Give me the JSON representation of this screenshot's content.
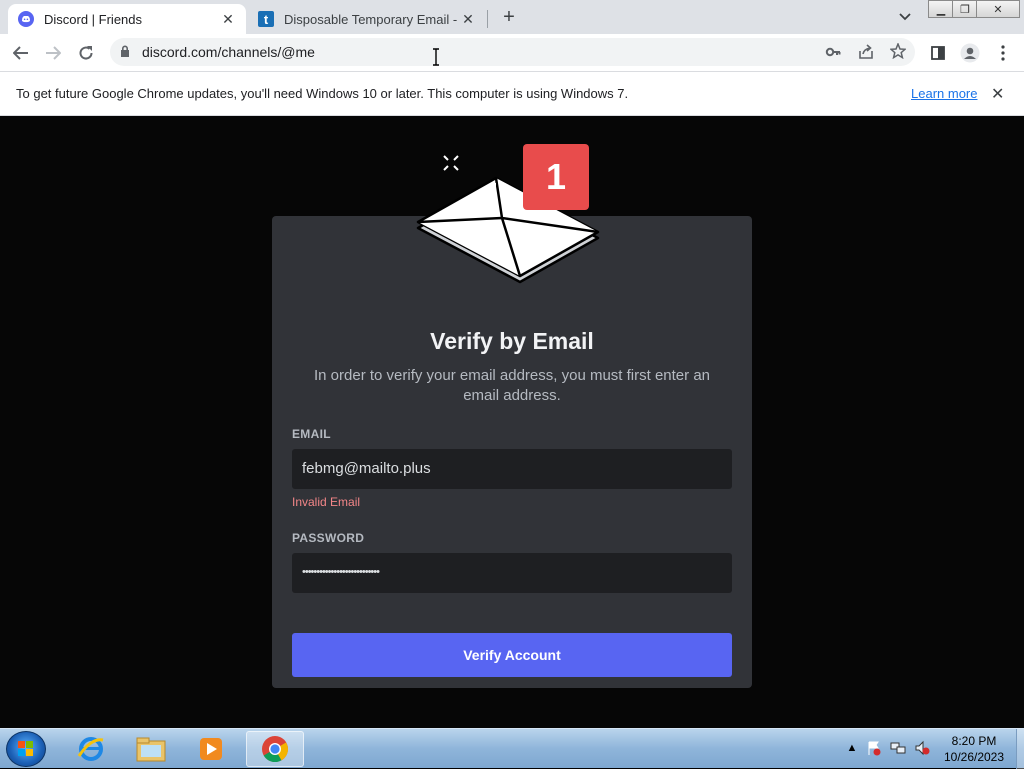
{
  "browser": {
    "tabs": [
      {
        "title": "Discord | Friends",
        "favicon": "discord-icon",
        "active": true
      },
      {
        "title": "Disposable Temporary Email - Te",
        "favicon": "t-icon",
        "active": false
      }
    ],
    "address_bar": {
      "url": "discord.com/channels/@me"
    },
    "infobar": {
      "message": "To get future Google Chrome updates, you'll need Windows 10 or later. This computer is using Windows 7.",
      "link": "Learn more"
    }
  },
  "modal": {
    "badge": "1",
    "title": "Verify by Email",
    "subtitle": "In order to verify your email address, you must first enter an email address.",
    "email": {
      "label": "EMAIL",
      "value": "febmg@mailto.plus",
      "error": "Invalid Email"
    },
    "password": {
      "label": "PASSWORD",
      "value": "•••••••••••••••••••••••••••"
    },
    "button": "Verify Account"
  },
  "taskbar": {
    "apps": [
      "internet-explorer-icon",
      "file-explorer-icon",
      "media-player-icon",
      "chrome-icon"
    ],
    "active_app": "chrome-icon",
    "time": "8:20 PM",
    "date": "10/26/2023"
  },
  "colors": {
    "brand": "#5865f2",
    "modal_bg": "#313338",
    "badge": "#e84c4c",
    "error": "#f38688"
  }
}
